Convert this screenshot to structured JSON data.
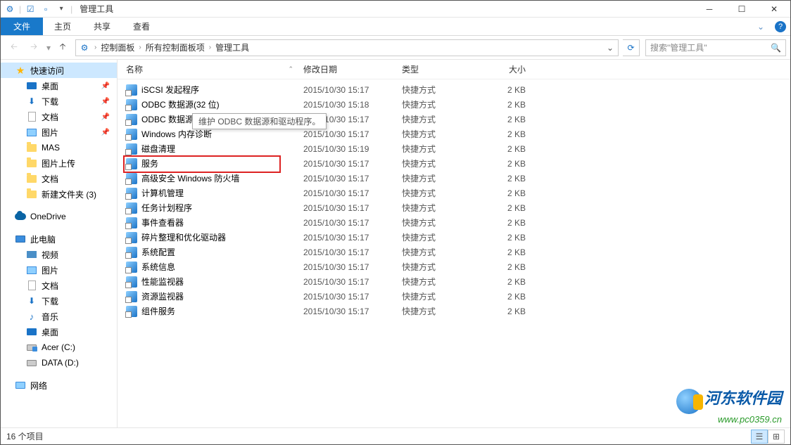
{
  "window": {
    "title": "管理工具"
  },
  "ribbon": {
    "file": "文件",
    "tabs": [
      "主页",
      "共享",
      "查看"
    ]
  },
  "breadcrumb": {
    "items": [
      "控制面板",
      "所有控制面板项",
      "管理工具"
    ]
  },
  "search": {
    "placeholder": "搜索\"管理工具\""
  },
  "sidebar": {
    "quick_access": "快速访问",
    "quick_items": [
      {
        "label": "桌面",
        "icon": "desktop",
        "pinned": true
      },
      {
        "label": "下载",
        "icon": "download",
        "pinned": true
      },
      {
        "label": "文档",
        "icon": "doc",
        "pinned": true
      },
      {
        "label": "图片",
        "icon": "pic",
        "pinned": true
      },
      {
        "label": "MAS",
        "icon": "folder",
        "pinned": false
      },
      {
        "label": "图片上传",
        "icon": "folder",
        "pinned": false
      },
      {
        "label": "文档",
        "icon": "folder",
        "pinned": false
      },
      {
        "label": "新建文件夹 (3)",
        "icon": "folder",
        "pinned": false
      }
    ],
    "onedrive": "OneDrive",
    "this_pc": "此电脑",
    "pc_items": [
      {
        "label": "视频",
        "icon": "video"
      },
      {
        "label": "图片",
        "icon": "pic"
      },
      {
        "label": "文档",
        "icon": "doc"
      },
      {
        "label": "下载",
        "icon": "download"
      },
      {
        "label": "音乐",
        "icon": "music"
      },
      {
        "label": "桌面",
        "icon": "desktop"
      },
      {
        "label": "Acer (C:)",
        "icon": "drive-c"
      },
      {
        "label": "DATA (D:)",
        "icon": "drive"
      }
    ],
    "network": "网络"
  },
  "columns": {
    "name": "名称",
    "date": "修改日期",
    "type": "类型",
    "size": "大小"
  },
  "files": [
    {
      "name": "iSCSI 发起程序",
      "date": "2015/10/30 15:17",
      "type": "快捷方式",
      "size": "2 KB"
    },
    {
      "name": "ODBC 数据源(32 位)",
      "date": "2015/10/30 15:18",
      "type": "快捷方式",
      "size": "2 KB"
    },
    {
      "name": "ODBC 数据源(64 位)",
      "date": "2015/10/30 15:17",
      "type": "快捷方式",
      "size": "2 KB"
    },
    {
      "name": "Windows 内存诊断",
      "date": "2015/10/30 15:17",
      "type": "快捷方式",
      "size": "2 KB"
    },
    {
      "name": "磁盘清理",
      "date": "2015/10/30 15:19",
      "type": "快捷方式",
      "size": "2 KB"
    },
    {
      "name": "服务",
      "date": "2015/10/30 15:17",
      "type": "快捷方式",
      "size": "2 KB",
      "highlight": true
    },
    {
      "name": "高级安全 Windows 防火墙",
      "date": "2015/10/30 15:17",
      "type": "快捷方式",
      "size": "2 KB"
    },
    {
      "name": "计算机管理",
      "date": "2015/10/30 15:17",
      "type": "快捷方式",
      "size": "2 KB"
    },
    {
      "name": "任务计划程序",
      "date": "2015/10/30 15:17",
      "type": "快捷方式",
      "size": "2 KB"
    },
    {
      "name": "事件查看器",
      "date": "2015/10/30 15:17",
      "type": "快捷方式",
      "size": "2 KB"
    },
    {
      "name": "碎片整理和优化驱动器",
      "date": "2015/10/30 15:17",
      "type": "快捷方式",
      "size": "2 KB"
    },
    {
      "name": "系统配置",
      "date": "2015/10/30 15:17",
      "type": "快捷方式",
      "size": "2 KB"
    },
    {
      "name": "系统信息",
      "date": "2015/10/30 15:17",
      "type": "快捷方式",
      "size": "2 KB"
    },
    {
      "name": "性能监视器",
      "date": "2015/10/30 15:17",
      "type": "快捷方式",
      "size": "2 KB"
    },
    {
      "name": "资源监视器",
      "date": "2015/10/30 15:17",
      "type": "快捷方式",
      "size": "2 KB"
    },
    {
      "name": "组件服务",
      "date": "2015/10/30 15:17",
      "type": "快捷方式",
      "size": "2 KB"
    }
  ],
  "tooltip": {
    "text": "维护 ODBC 数据源和驱动程序。"
  },
  "statusbar": {
    "count": "16 个项目"
  },
  "watermark": {
    "title": "河东软件园",
    "url": "www.pc0359.cn"
  }
}
